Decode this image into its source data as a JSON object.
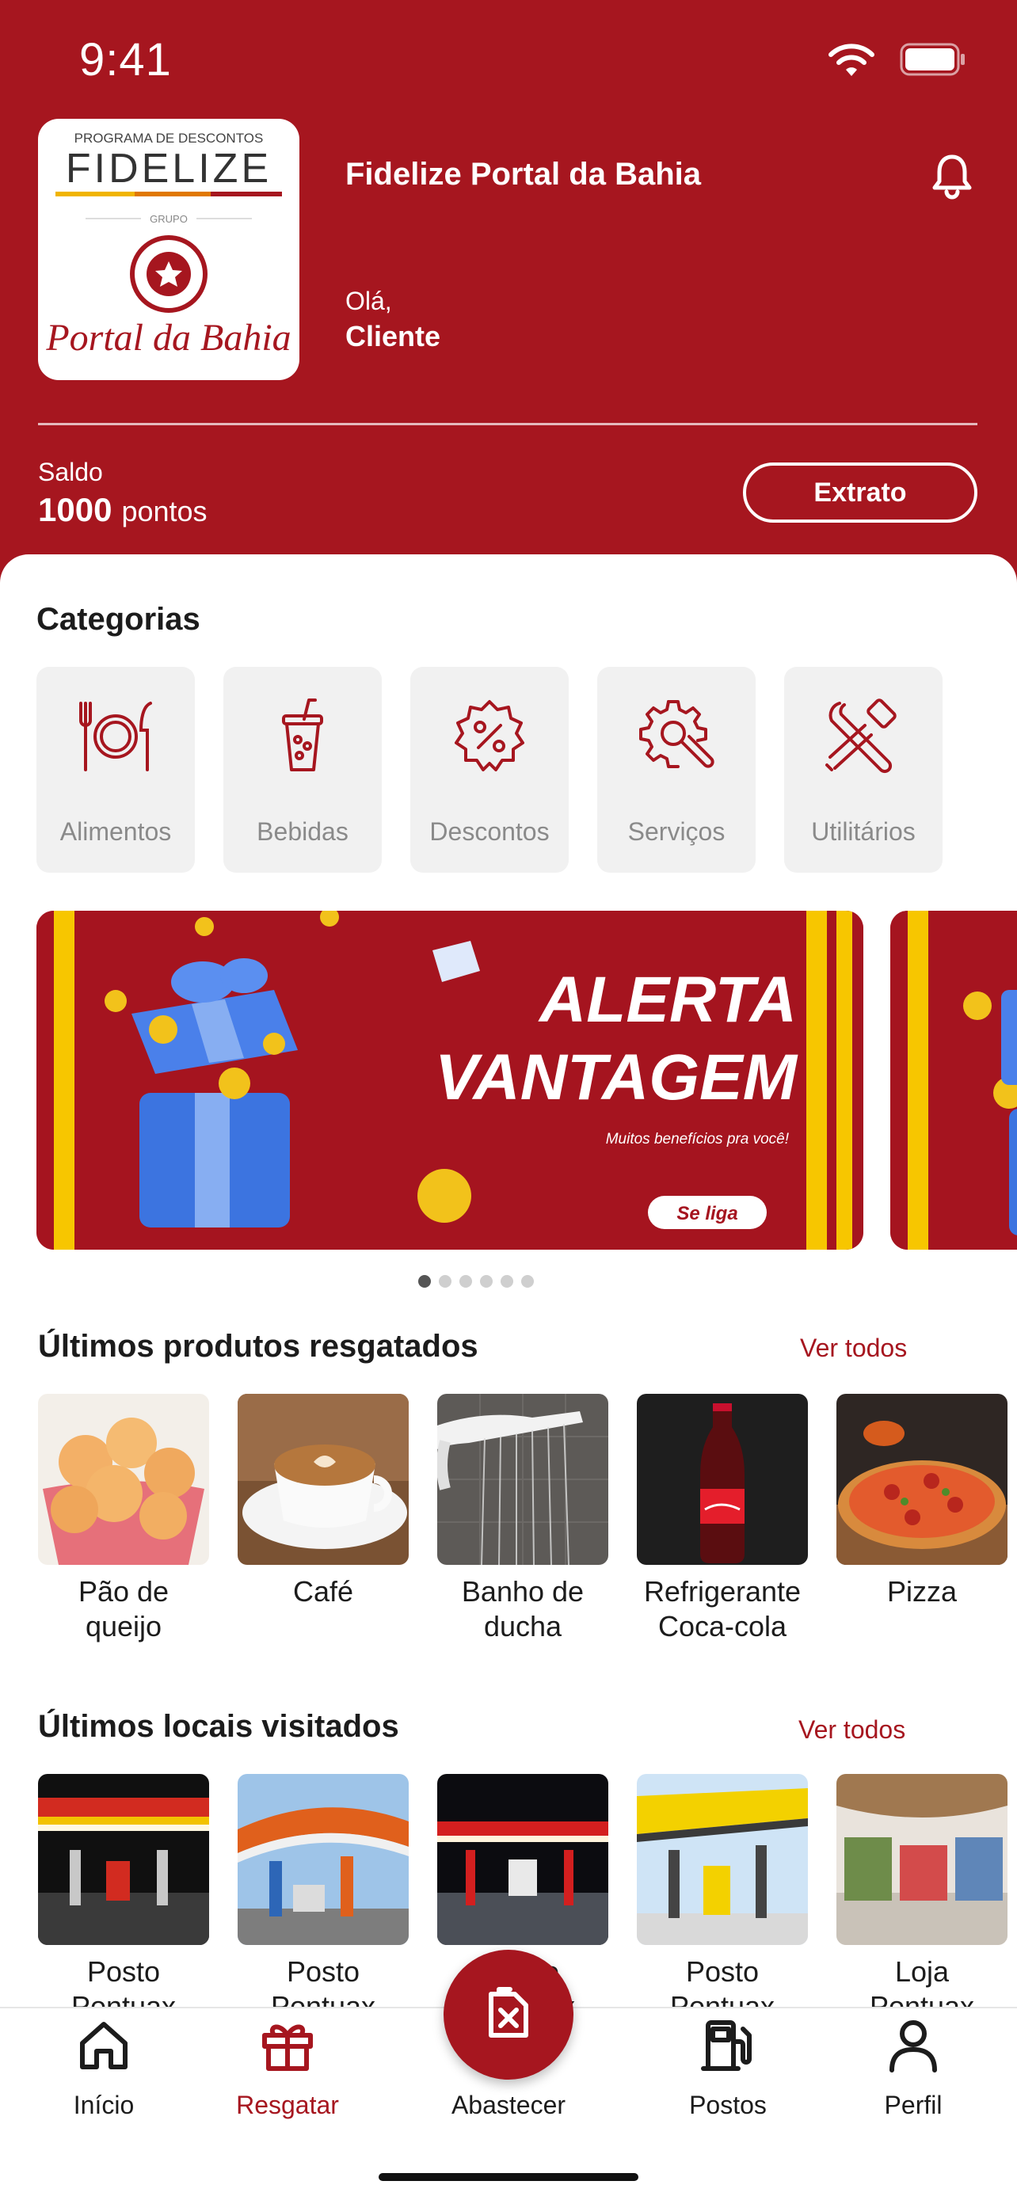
{
  "status_bar": {
    "time": "9:41"
  },
  "header": {
    "logo": {
      "line1": "PROGRAMA DE DESCONTOS",
      "line2": "FIDELIZE",
      "line3": "GRUPO",
      "line4": "Portal da Bahia"
    },
    "title": "Fidelize Portal da Bahia",
    "greeting": "Olá,",
    "user": "Cliente",
    "saldo_label": "Saldo",
    "saldo_value": "1000",
    "saldo_unit": "pontos",
    "extrato_label": "Extrato"
  },
  "categories": {
    "title": "Categorias",
    "items": [
      {
        "label": "Alimentos",
        "icon": "plate-cutlery-icon"
      },
      {
        "label": "Bebidas",
        "icon": "drink-cup-icon"
      },
      {
        "label": "Descontos",
        "icon": "percent-badge-icon"
      },
      {
        "label": "Serviços",
        "icon": "gear-wrench-icon"
      },
      {
        "label": "Utilitários",
        "icon": "tools-icon"
      }
    ]
  },
  "banner": {
    "line1": "ALERTA",
    "line2": "VANTAGEM",
    "tagline": "Muitos benefícios pra você!",
    "cta": "Se liga",
    "slide_count": 6,
    "active_slide": 1
  },
  "recent_products": {
    "title": "Últimos produtos resgatados",
    "see_all": "Ver todos",
    "items": [
      {
        "line1": "Pão de",
        "line2": "queijo"
      },
      {
        "line1": "Café",
        "line2": ""
      },
      {
        "line1": "Banho de",
        "line2": "ducha"
      },
      {
        "line1": "Refrigerante",
        "line2": "Coca-cola"
      },
      {
        "line1": "Pizza",
        "line2": ""
      }
    ]
  },
  "recent_places": {
    "title": "Últimos locais visitados",
    "see_all": "Ver todos",
    "items": [
      {
        "line1": "Posto",
        "line2": "Pontuax"
      },
      {
        "line1": "Posto",
        "line2": "Pontuax"
      },
      {
        "line1": "Posto",
        "line2": "Pontuax"
      },
      {
        "line1": "Posto",
        "line2": "Pontuax"
      },
      {
        "line1": "Loja",
        "line2": "Pontuax"
      }
    ]
  },
  "bottom_nav": {
    "items": [
      {
        "label": "Início",
        "icon": "home-icon"
      },
      {
        "label": "Resgatar",
        "icon": "gift-icon",
        "active": true
      },
      {
        "label": "Abastecer",
        "icon": "fuel-can-icon"
      },
      {
        "label": "Postos",
        "icon": "fuel-pump-icon"
      },
      {
        "label": "Perfil",
        "icon": "user-icon"
      }
    ]
  },
  "colors": {
    "brand": "#a6161f",
    "accent_yellow": "#f7c600",
    "card_bg": "#f1f1f1"
  }
}
